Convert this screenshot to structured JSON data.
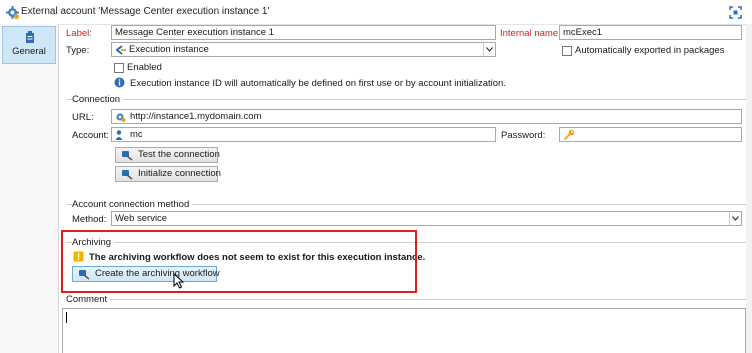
{
  "window": {
    "title": "External account 'Message Center execution instance 1'"
  },
  "sidebar": {
    "tabs": [
      {
        "label": "General"
      }
    ]
  },
  "form": {
    "label_label": "Label:",
    "label_value": "Message Center execution instance 1",
    "internal_name_label": "Internal name:",
    "internal_name_value": "mcExec1",
    "type_label": "Type:",
    "type_value": "Execution instance",
    "auto_export_label": "Automatically exported in packages",
    "enabled_label": "Enabled",
    "info_text": "Execution instance ID will automatically be defined on first use or by account initialization."
  },
  "connection": {
    "title": "Connection",
    "url_label": "URL:",
    "url_value": "http://instance1.mydomain.com",
    "account_label": "Account:",
    "account_value": "mc",
    "password_label": "Password:",
    "test_button": "Test the connection",
    "init_button": "Initialize connection"
  },
  "account_method": {
    "title": "Account connection method",
    "method_label": "Method:",
    "method_value": "Web service"
  },
  "archiving": {
    "title": "Archiving",
    "warning_text": "The archiving workflow does not seem to exist for this execution instance.",
    "create_button": "Create the archiving workflow"
  },
  "comment": {
    "title": "Comment",
    "value": ""
  },
  "colors": {
    "highlight": "#e01e1e",
    "required": "#d42020",
    "selected_tab": "#cfe6f7"
  }
}
